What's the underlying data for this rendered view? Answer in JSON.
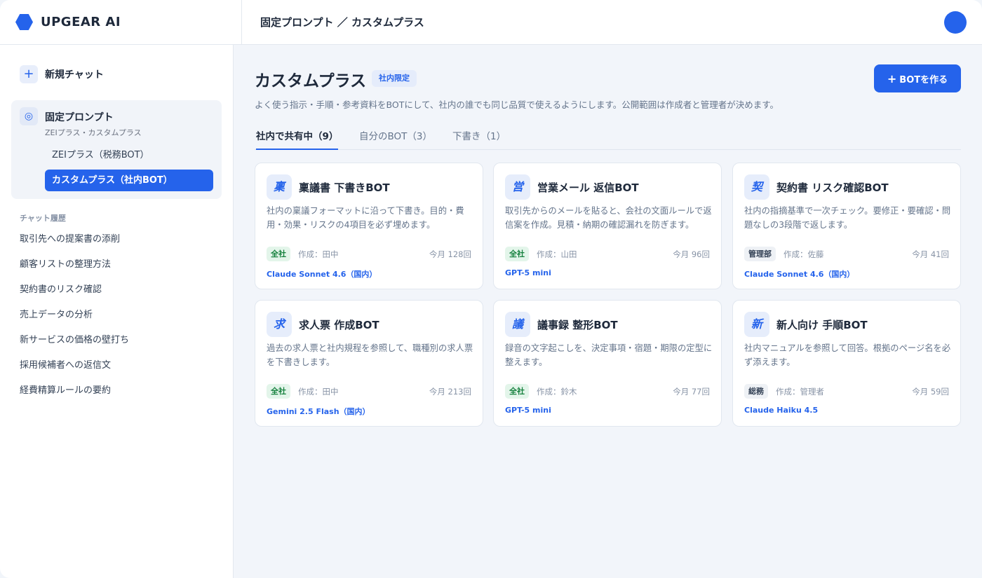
{
  "app": {
    "brand": "UPGEAR AI",
    "brand_color": "#2563eb"
  },
  "header": {
    "breadcrumb": "固定プロンプト ／ カスタムプラス"
  },
  "sidebar": {
    "new_chat": "新規チャット",
    "fixed_prompts": {
      "title": "固定プロンプト",
      "subtitle": "ZEIプラス・カスタムプラス",
      "items": [
        {
          "label": "ZEIプラス（税務BOT）"
        },
        {
          "label": "カスタムプラス（社内BOT）"
        }
      ]
    },
    "history_heading": "チャット履歴",
    "history": [
      "取引先への提案書の添削",
      "顧客リストの整理方法",
      "契約書のリスク確認",
      "売上データの分析",
      "新サービスの価格の壁打ち",
      "採用候補者への返信文",
      "経費精算ルールの要約"
    ]
  },
  "main": {
    "title": "カスタムプラス",
    "badge": "社内限定",
    "create_button": "BOTを作る",
    "description": "よく使う指示・手順・参考資料をBOTにして、社内の誰でも同じ品質で使えるようにします。公開範囲は作成者と管理者が決めます。",
    "tabs": [
      {
        "label": "社内で共有中（9）"
      },
      {
        "label": "自分のBOT（3）"
      },
      {
        "label": "下書き（1）"
      }
    ],
    "cards": [
      {
        "icon": "稟",
        "title": "稟議書 下書きBOT",
        "description": "社内の稟議フォーマットに沿って下書き。目的・費用・効果・リスクの4項目を必ず埋めます。",
        "scope": "全社",
        "author": "作成：田中",
        "usage": "今月 128回",
        "model": "Claude Sonnet 4.6（国内）"
      },
      {
        "icon": "営",
        "title": "営業メール 返信BOT",
        "description": "取引先からのメールを貼ると、会社の文面ルールで返信案を作成。見積・納期の確認漏れを防ぎます。",
        "scope": "全社",
        "author": "作成：山田",
        "usage": "今月 96回",
        "model": "GPT-5 mini"
      },
      {
        "icon": "契",
        "title": "契約書 リスク確認BOT",
        "description": "社内の指摘基準で一次チェック。要修正・要確認・問題なしの3段階で返します。",
        "scope": "管理部",
        "author": "作成：佐藤",
        "usage": "今月 41回",
        "model": "Claude Sonnet 4.6（国内）"
      },
      {
        "icon": "求",
        "title": "求人票 作成BOT",
        "description": "過去の求人票と社内規程を参照して、職種別の求人票を下書きします。",
        "scope": "全社",
        "author": "作成：田中",
        "usage": "今月 213回",
        "model": "Gemini 2.5 Flash（国内）"
      },
      {
        "icon": "議",
        "title": "議事録 整形BOT",
        "description": "録音の文字起こしを、決定事項・宿題・期限の定型に整えます。",
        "scope": "全社",
        "author": "作成：鈴木",
        "usage": "今月 77回",
        "model": "GPT-5 mini"
      },
      {
        "icon": "新",
        "title": "新人向け 手順BOT",
        "description": "社内マニュアルを参照して回答。根拠のページ名を必ず添えます。",
        "scope": "総務",
        "author": "作成：管理者",
        "usage": "今月 59回",
        "model": "Claude Haiku 4.5"
      }
    ]
  }
}
